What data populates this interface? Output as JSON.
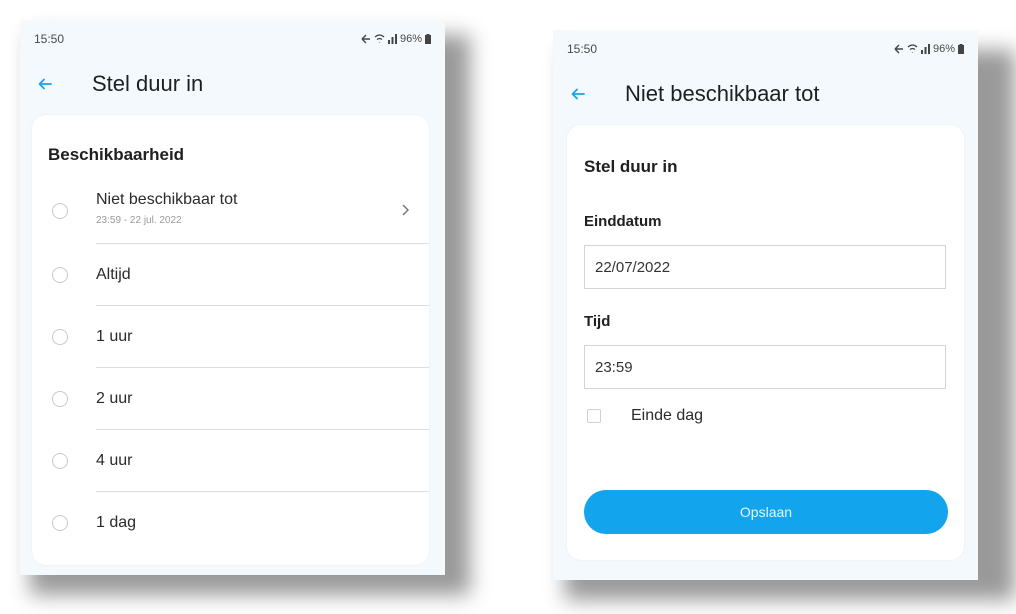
{
  "colors": {
    "accent": "#12a4ec",
    "background": "#f3f9fd",
    "card": "#ffffff"
  },
  "left_screen": {
    "status": {
      "time": "15:50",
      "battery": "96%"
    },
    "appbar": {
      "title": "Stel duur in",
      "back_icon": "arrow-left-icon"
    },
    "section_title": "Beschikbaarheid",
    "options": [
      {
        "label": "Niet beschikbaar tot",
        "sublabel": "23:59 - 22 jul. 2022",
        "has_chevron": true
      },
      {
        "label": "Altijd"
      },
      {
        "label": "1 uur"
      },
      {
        "label": "2 uur"
      },
      {
        "label": "4 uur"
      },
      {
        "label": "1 dag"
      }
    ]
  },
  "right_screen": {
    "status": {
      "time": "15:50",
      "battery": "96%"
    },
    "appbar": {
      "title": "Niet beschikbaar tot",
      "back_icon": "arrow-left-icon"
    },
    "section_title": "Stel duur in",
    "end_date": {
      "label": "Einddatum",
      "value": "22/07/2022"
    },
    "time": {
      "label": "Tijd",
      "value": "23:59"
    },
    "end_of_day": {
      "label": "Einde dag",
      "checked": false
    },
    "save_label": "Opslaan"
  }
}
